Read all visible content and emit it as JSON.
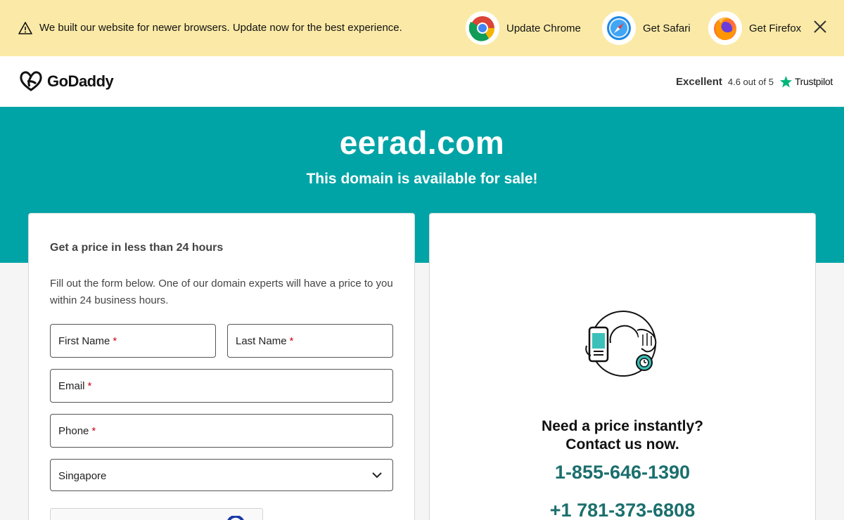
{
  "banner": {
    "message": "We built our website for newer browsers. Update now for the best experience.",
    "buttons": [
      {
        "label": "Update Chrome",
        "icon": "chrome-icon"
      },
      {
        "label": "Get Safari",
        "icon": "safari-icon"
      },
      {
        "label": "Get Firefox",
        "icon": "firefox-icon"
      }
    ]
  },
  "header": {
    "brand": "GoDaddy",
    "trust_rating_word": "Excellent",
    "trust_score": "4.6 out of 5",
    "trust_brand": "Trustpilot"
  },
  "hero": {
    "domain": "eerad.com",
    "subtitle": "This domain is available for sale!"
  },
  "form": {
    "title": "Get a price in less than 24 hours",
    "description": "Fill out the form below. One of our domain experts will have a price to you within 24 business hours.",
    "first_name": "First Name",
    "last_name": "Last Name",
    "email": "Email",
    "phone": "Phone",
    "required_mark": "*",
    "country": "Singapore"
  },
  "contact": {
    "line1": "Need a price instantly?",
    "line2": "Contact us now.",
    "phone1": "1-855-646-1390",
    "phone2": "+1 781-373-6808"
  },
  "colors": {
    "banner_bg": "#fbeaa7",
    "hero_bg": "#00a4a6",
    "phone_text": "#1b6f6e",
    "required": "#d0021b",
    "trustpilot_star": "#00b67a"
  }
}
